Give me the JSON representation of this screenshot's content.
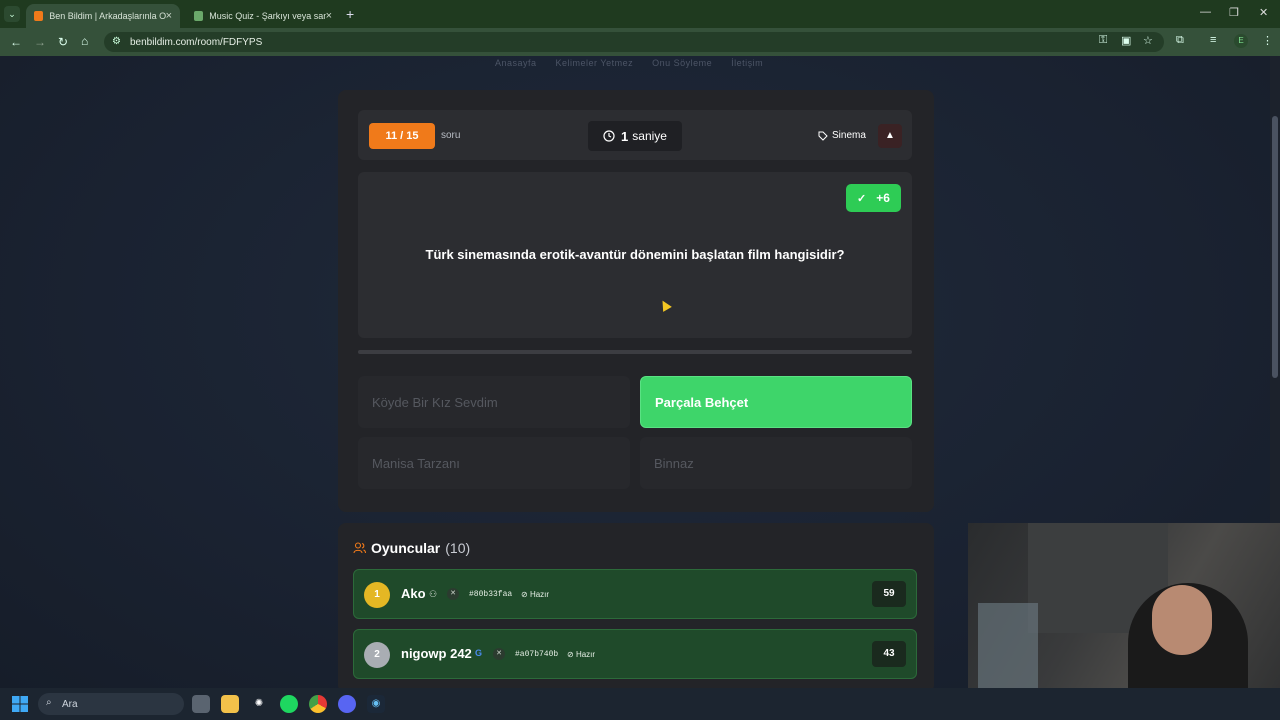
{
  "browser": {
    "tabs": [
      {
        "title": "Ben Bildim | Arkadaşlarınla Onli",
        "active": true
      },
      {
        "title": "Music Quiz - Şarkıyı veya sanat",
        "active": false
      }
    ],
    "new_tab": "+",
    "url": "benbildim.com/room/FDFYPS",
    "profile_letter": "E",
    "accent": "#35513a"
  },
  "site": {
    "nav": [
      "Anasayfa",
      "Kelimeler Yetmez",
      "Onu Söyleme",
      "İletişim"
    ]
  },
  "quiz": {
    "counter": "11 / 15",
    "counter_label": "soru",
    "timer_value": "1",
    "timer_unit": "saniye",
    "category": "Sinema",
    "warn_icon": "▲",
    "points": "+6",
    "question": "Türk sinemasında erotik-avantür dönemini başlatan film hangisidir?",
    "answers": [
      {
        "text": "Köyde Bir Kız Sevdim",
        "state": "disabled"
      },
      {
        "text": "Parçala Behçet",
        "state": "correct"
      },
      {
        "text": "Manisa Tarzanı",
        "state": "disabled"
      },
      {
        "text": "Binnaz",
        "state": "disabled"
      }
    ],
    "colors": {
      "counter": "#f07a1a",
      "correct": "#3ed56a",
      "score": "#2ecc55"
    }
  },
  "players": {
    "title": "Oyuncular",
    "count": "(10)",
    "list": [
      {
        "rank": "1",
        "name": "Ako",
        "id": "#80b33faa",
        "status": "Hazır",
        "score": "59",
        "rank_color": "#e4b724"
      },
      {
        "rank": "2",
        "name": "nigowp 242",
        "id": "#a07b740b",
        "status": "Hazır",
        "score": "43",
        "rank_color": "#a9adb3"
      }
    ]
  },
  "taskbar": {
    "search_placeholder": "Ara",
    "apps": [
      "file-explorer-icon",
      "chatgpt-icon",
      "spotify-icon",
      "chrome-icon",
      "discord-icon",
      "steam-icon"
    ]
  }
}
